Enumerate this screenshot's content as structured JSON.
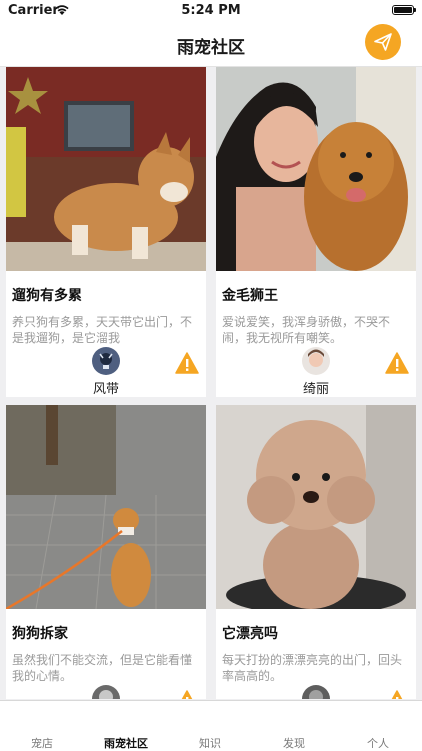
{
  "status_bar": {
    "carrier": "Carrier",
    "time": "5:24 PM"
  },
  "nav": {
    "title": "雨宠社区",
    "action_icon": "paper-plane-icon",
    "accent": "#f5a623"
  },
  "posts": [
    {
      "title": "遛狗有多累",
      "desc": "养只狗有多累，天天带它出门，不是我遛狗，是它溜我",
      "author": "风带",
      "photo": "corgi-photo",
      "badge": "warning-icon"
    },
    {
      "title": "金毛狮王",
      "desc": "爱说爱笑，我浑身骄傲，不哭不闹，我无视所有嘲笑。",
      "author": "绮丽",
      "photo": "golden-retriever-photo",
      "badge": "warning-icon"
    },
    {
      "title": "狗狗拆家",
      "desc": "虽然我们不能交流，但是它能看懂我的心情。",
      "author": "",
      "photo": "dog-on-leash-photo",
      "badge": "warning-icon"
    },
    {
      "title": "它漂亮吗",
      "desc": "每天打扮的漂漂亮亮的出门，回头率高高的。",
      "author": "",
      "photo": "poodle-photo",
      "badge": "warning-icon"
    }
  ],
  "tabs": [
    {
      "label": "宠店"
    },
    {
      "label": "雨宠社区",
      "active": true
    },
    {
      "label": "知识"
    },
    {
      "label": "发现"
    },
    {
      "label": "个人"
    }
  ]
}
